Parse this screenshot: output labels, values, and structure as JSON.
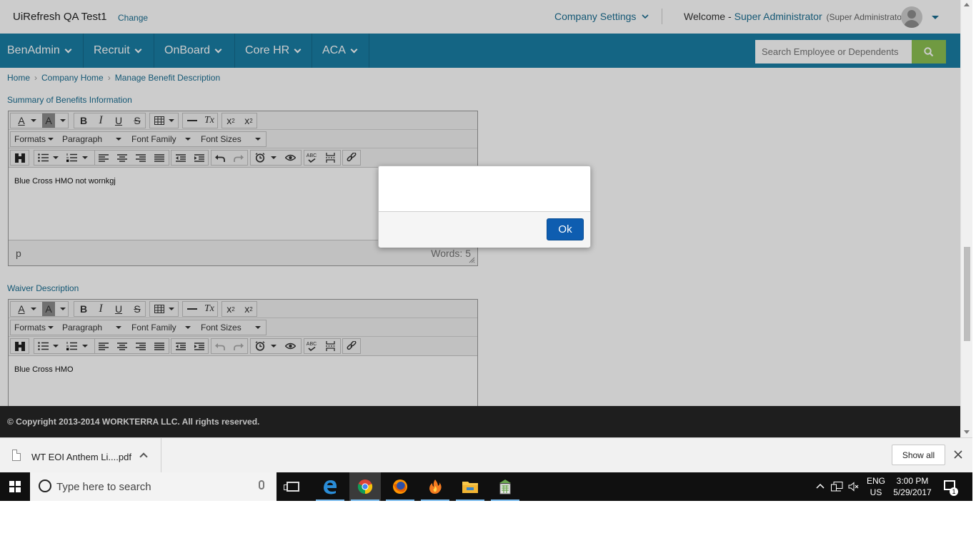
{
  "header": {
    "app_title": "UiRefresh QA Test1",
    "change_label": "Change",
    "company_settings": "Company Settings",
    "welcome_label": "Welcome -",
    "user_name": "Super Administrator",
    "user_role": "(Super Administrator)"
  },
  "nav": {
    "items": [
      "BenAdmin",
      "Recruit",
      "OnBoard",
      "Core HR",
      "ACA"
    ],
    "search_placeholder": "Search Employee or Dependents"
  },
  "breadcrumb": [
    "Home",
    "Company Home",
    "Manage Benefit Description"
  ],
  "editors": [
    {
      "label": "Summary of Benefits Information",
      "content": "Blue Cross HMO not wornkgj",
      "status_path": "p",
      "word_count": "Words: 5"
    },
    {
      "label": "Waiver Description",
      "content": "Blue Cross HMO"
    }
  ],
  "toolbar": {
    "formats": "Formats",
    "paragraph": "Paragraph",
    "font_family": "Font Family",
    "font_sizes": "Font Sizes",
    "bold": "B",
    "italic": "I",
    "underline": "U",
    "strike": "S",
    "font_color": "A",
    "clear_format": "Tx",
    "subscript": "x",
    "superscript": "x",
    "sub_mark": "2",
    "sup_mark": "2",
    "spell": "ABC"
  },
  "dialog": {
    "message": "",
    "ok_label": "Ok"
  },
  "footer": {
    "copyright": "© Copyright 2013-2014 WORKTERRA LLC. All rights reserved."
  },
  "download_bar": {
    "file_name": "WT EOI Anthem Li....pdf",
    "show_all": "Show all"
  },
  "taskbar": {
    "search_placeholder": "Type here to search",
    "language_line1": "ENG",
    "language_line2": "US",
    "time": "3:00 PM",
    "date": "5/29/2017",
    "notification_count": "1"
  },
  "colors": {
    "nav_bg": "#1a7fa6",
    "link": "#1b6f93",
    "search_button": "#8cc152",
    "ok_button": "#0e5db0",
    "footer_bg": "#262626"
  }
}
